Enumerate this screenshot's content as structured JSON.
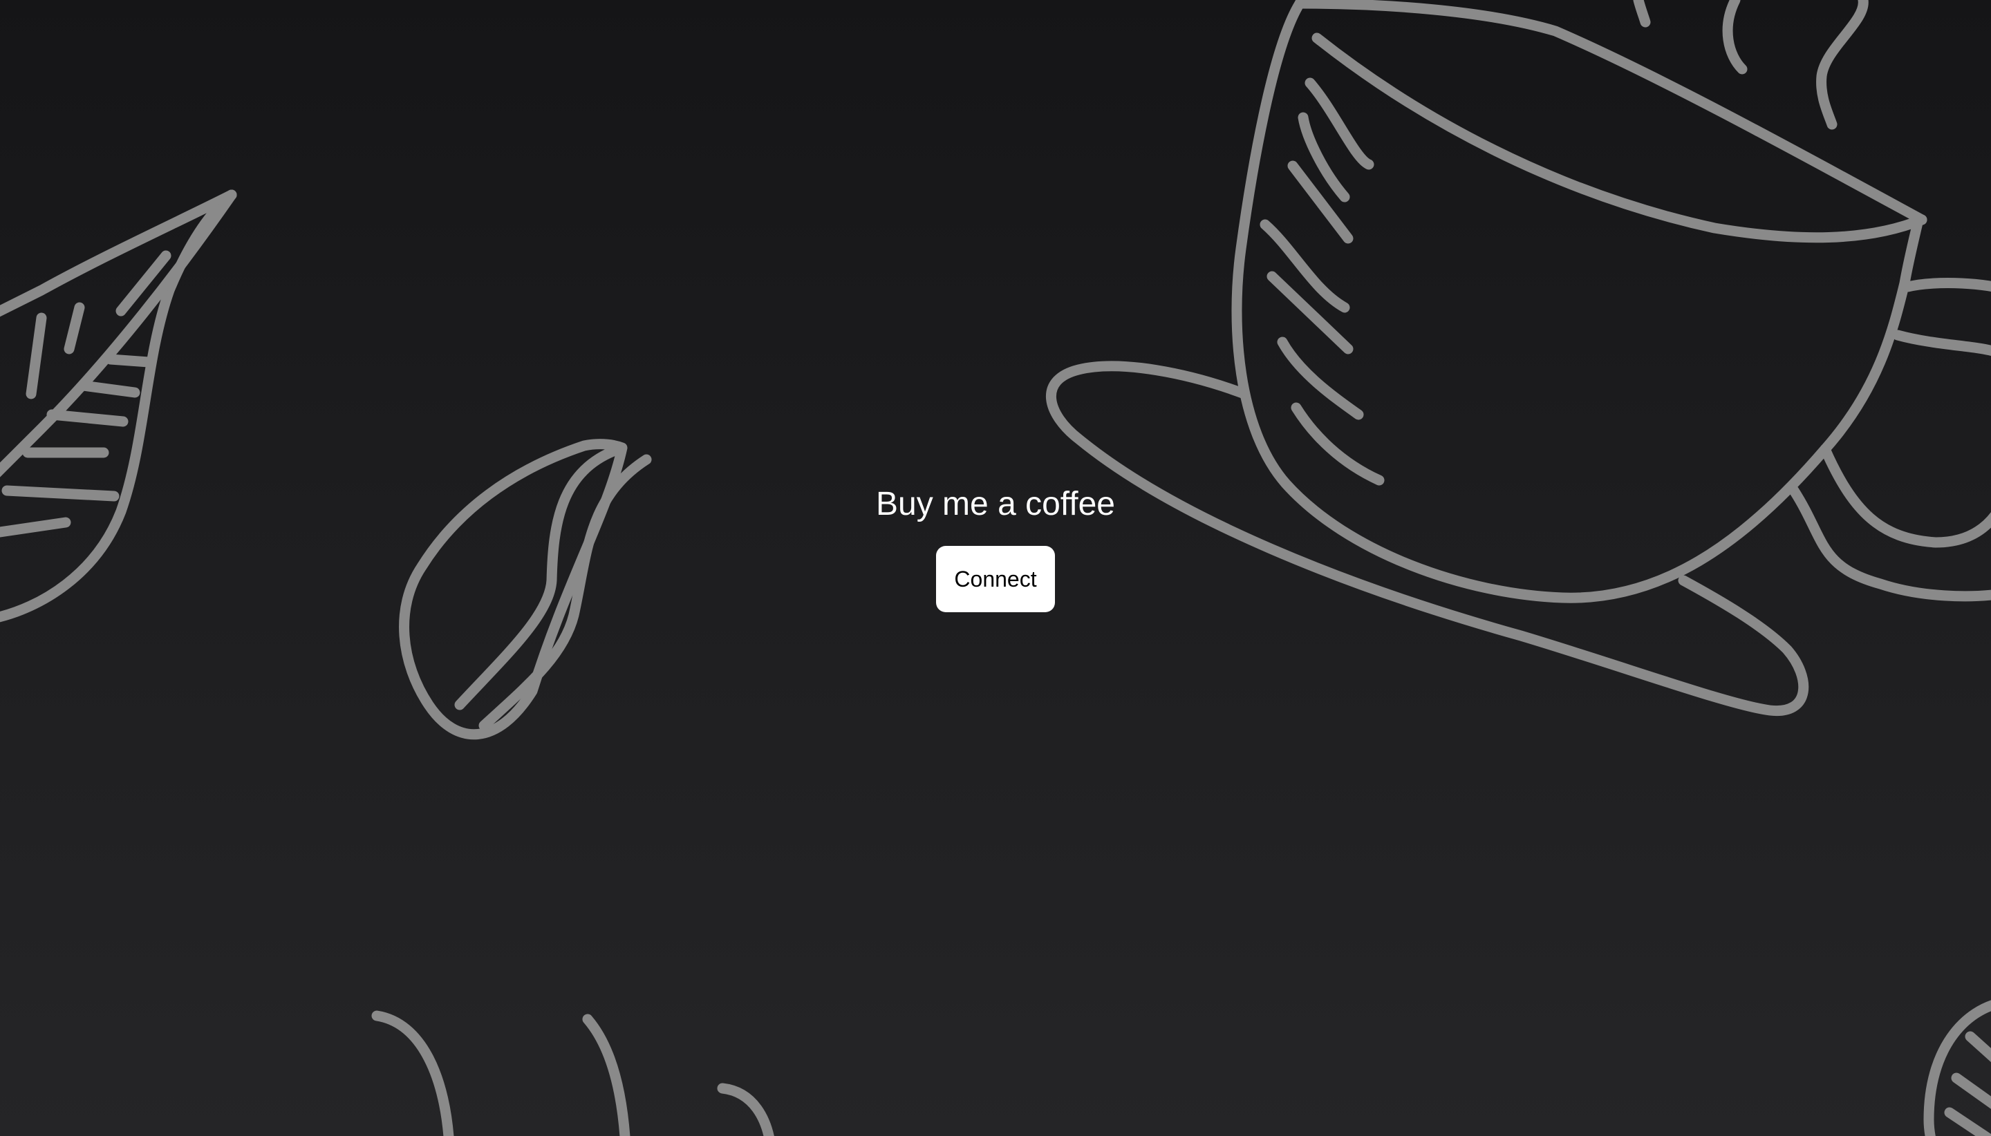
{
  "page": {
    "title": "Buy me a coffee"
  },
  "actions": {
    "connect_label": "Connect"
  },
  "decorations": [
    "coffee-leaf-icon",
    "coffee-bean-icon",
    "coffee-cup-icon",
    "steam-icon"
  ],
  "colors": {
    "background_top": "#151517",
    "background_bottom": "#252527",
    "doodle_stroke": "#8a8a8a",
    "button_bg": "#ffffff",
    "button_text": "#000000",
    "title_text": "#ffffff"
  }
}
